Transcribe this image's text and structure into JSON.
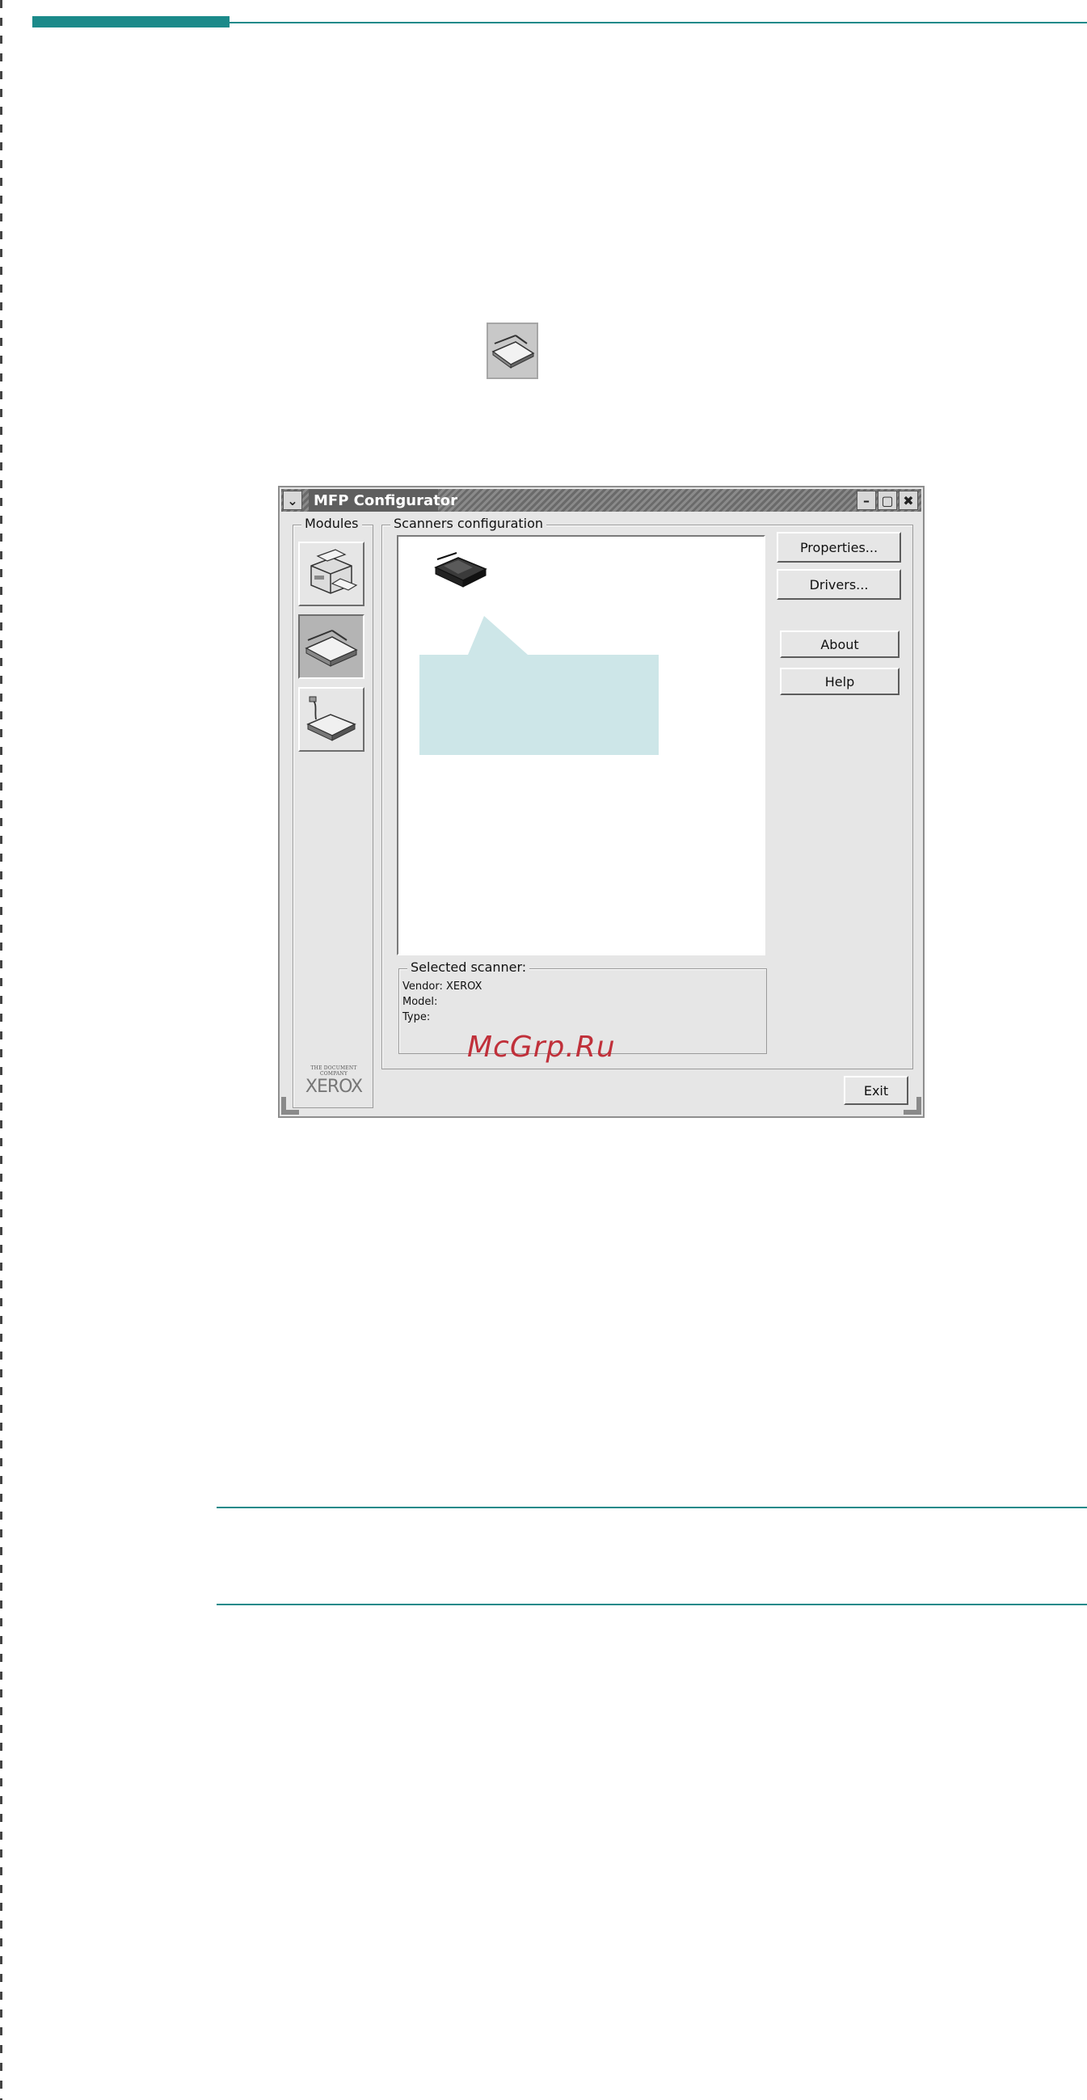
{
  "window": {
    "title": "MFP Configurator"
  },
  "modules": {
    "title": "Modules",
    "items": [
      {
        "name": "printers-module",
        "icon": "printer-icon",
        "active": false
      },
      {
        "name": "scanners-module",
        "icon": "scanner-icon",
        "active": true
      },
      {
        "name": "ports-module",
        "icon": "port-device-icon",
        "active": false
      }
    ],
    "logo_tagline": "THE DOCUMENT COMPANY",
    "logo_text": "XEROX"
  },
  "scanners": {
    "title": "Scanners configuration",
    "list_items": [
      {
        "icon": "scanner-device-icon"
      }
    ],
    "selected": {
      "title": "Selected scanner:",
      "vendor_label": "Vendor: XEROX",
      "model_label": "Model:",
      "type_label": "Type:"
    }
  },
  "buttons": {
    "properties": "Properties...",
    "drivers": "Drivers...",
    "about": "About",
    "help": "Help",
    "exit": "Exit"
  },
  "watermark": "McGrp.Ru",
  "colors": {
    "accent": "#1b8a8a",
    "callout": "#cde6e8",
    "watermark": "#c0303a"
  }
}
